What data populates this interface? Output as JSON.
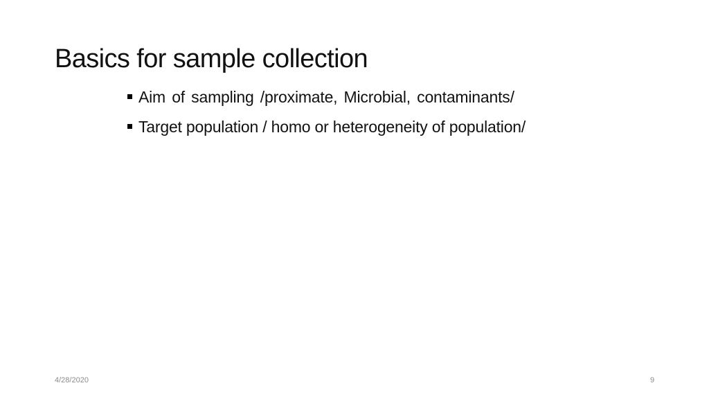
{
  "slide": {
    "title": "Basics for sample collection",
    "bullets": [
      {
        "text": "Aim of sampling /proximate, Microbial, contaminants/",
        "marker_icon": "square-bullet-icon"
      },
      {
        "text": "Target population / homo or heterogeneity of population/",
        "marker_icon": "square-bullet-icon"
      }
    ],
    "footer": {
      "date": "4/28/2020",
      "page_number": "9"
    }
  }
}
